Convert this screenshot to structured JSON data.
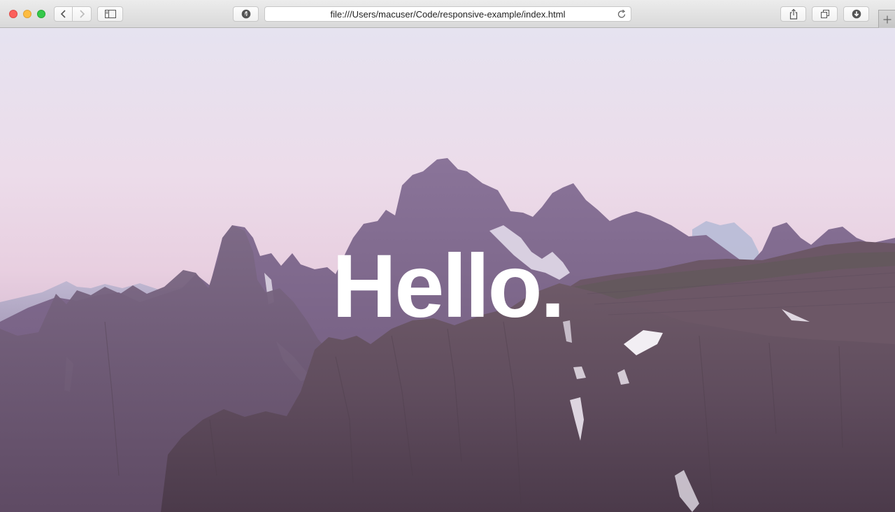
{
  "window": {
    "controls": [
      "close",
      "minimize",
      "zoom"
    ]
  },
  "toolbar": {
    "address": "file:///Users/macuser/Code/responsive-example/index.html",
    "icons": {
      "back": "chevron-left-icon",
      "forward": "chevron-right-icon",
      "sidebar": "sidebar-icon",
      "extension": "extension-icon",
      "reload": "reload-icon",
      "share": "share-icon",
      "tabs": "tabs-overview-icon",
      "downloads": "download-icon",
      "new_tab": "plus-icon"
    }
  },
  "page": {
    "hero_title": "Hello."
  },
  "colors": {
    "sky_top": "#e6e3f0",
    "sky_horizon": "#e4c5d8",
    "mountain": "#6e5a70",
    "title": "#ffffff"
  }
}
